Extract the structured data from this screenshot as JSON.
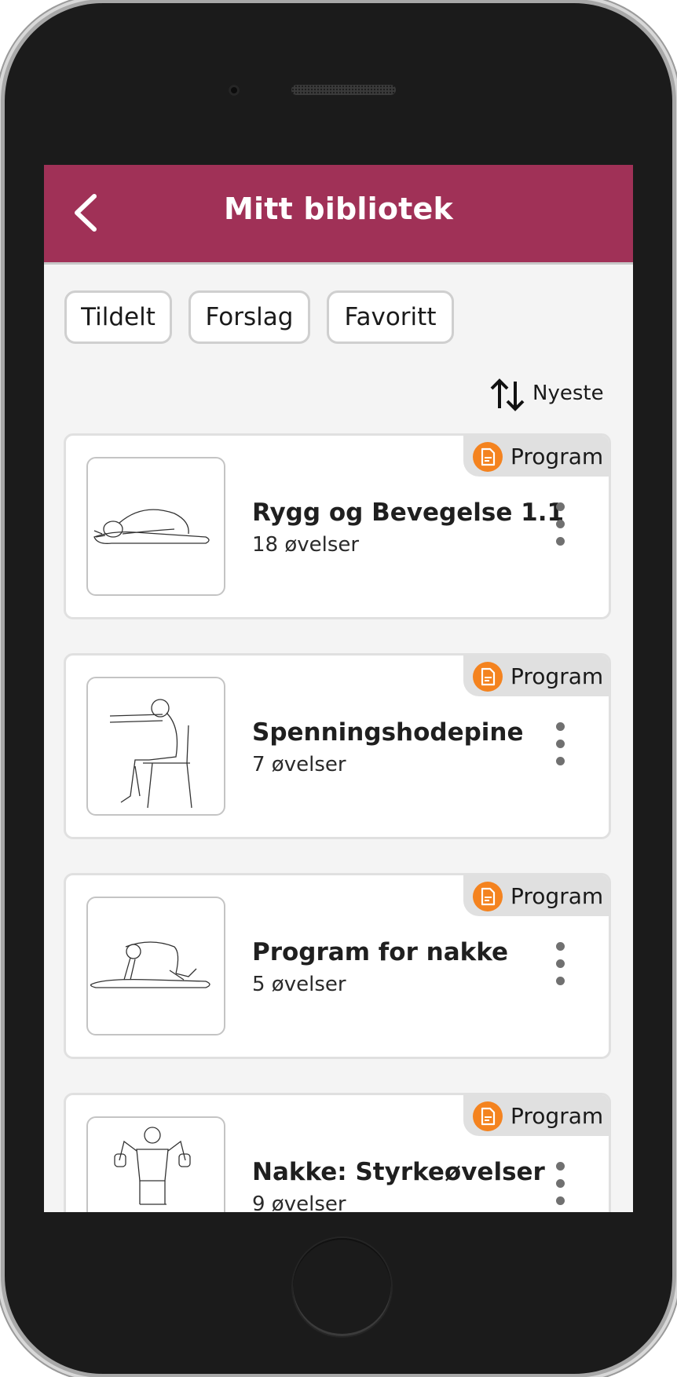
{
  "header": {
    "title": "Mitt bibliotek",
    "back_icon": "chevron-left-icon",
    "background_color": "#a03157"
  },
  "filters": [
    {
      "label": "Tildelt"
    },
    {
      "label": "Forslag"
    },
    {
      "label": "Favoritt"
    }
  ],
  "sort": {
    "label": "Nyeste",
    "icon": "sort-arrows-icon"
  },
  "badge_color": "#f4831f",
  "programs": [
    {
      "badge": "Program",
      "badge_icon": "document-icon",
      "title": "Rygg og Bevegelse 1.1",
      "subtitle": "18 øvelser",
      "thumbnail": "child-pose-stretch"
    },
    {
      "badge": "Program",
      "badge_icon": "document-icon",
      "title": "Spenningshodepine",
      "subtitle": "7 øvelser",
      "thumbnail": "seated-forward-reach"
    },
    {
      "badge": "Program",
      "badge_icon": "document-icon",
      "title": "Program for nakke",
      "subtitle": "5 øvelser",
      "thumbnail": "kneeling-on-mat"
    },
    {
      "badge": "Program",
      "badge_icon": "document-icon",
      "title": "Nakke: Styrkeøvelser",
      "subtitle": "9 øvelser",
      "thumbnail": "standing-dumbbell-raise"
    }
  ]
}
